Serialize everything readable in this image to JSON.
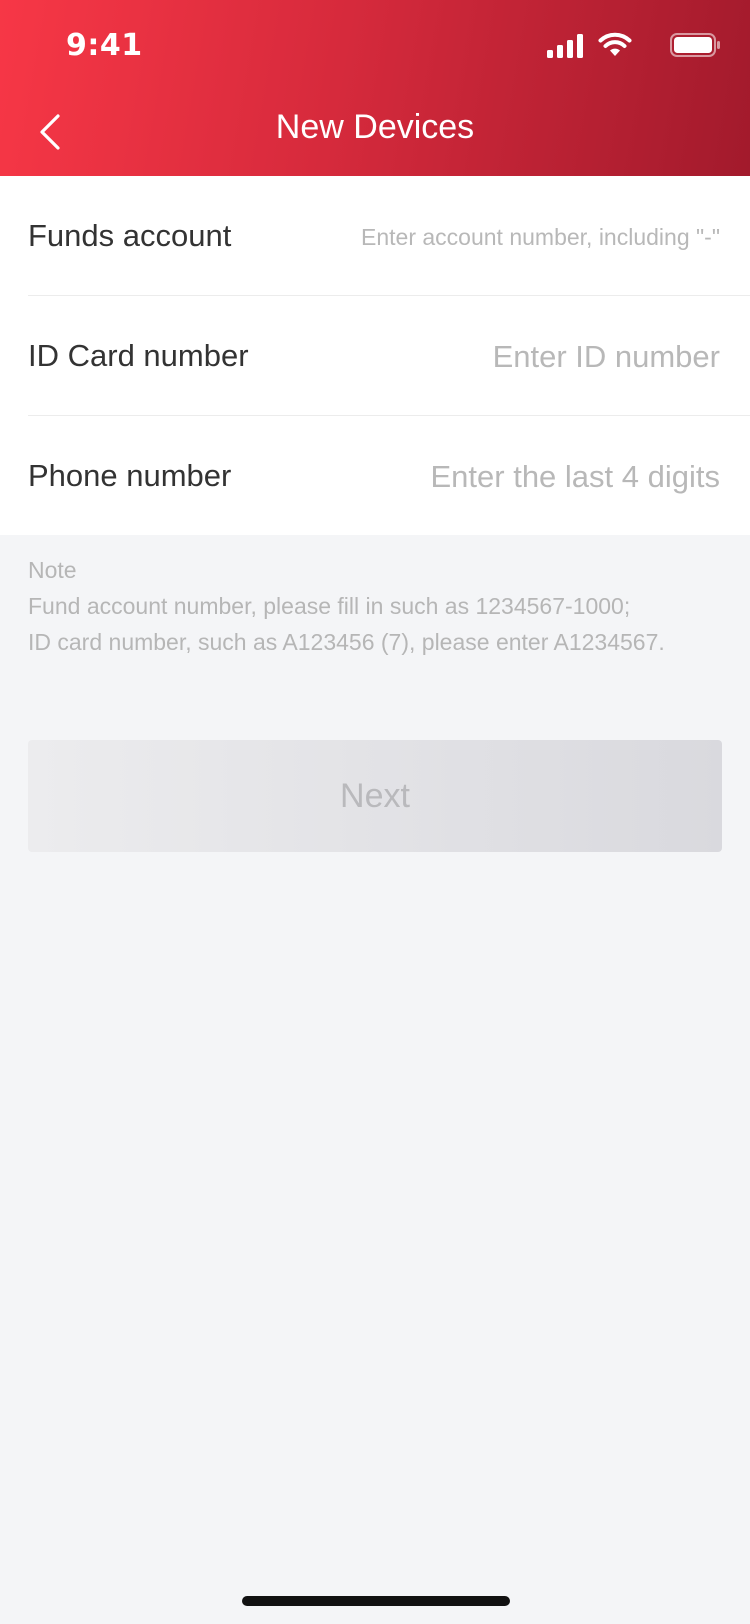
{
  "status_bar": {
    "time": "9:41"
  },
  "nav": {
    "title": "New Devices",
    "back_icon": "chevron-left-icon"
  },
  "form": {
    "fields": [
      {
        "label": "Funds account",
        "placeholder": "Enter account number, including \"-\"",
        "value": ""
      },
      {
        "label": "ID Card number",
        "placeholder": "Enter ID number",
        "value": ""
      },
      {
        "label": "Phone number",
        "placeholder": "Enter the last 4 digits",
        "value": ""
      }
    ]
  },
  "note": {
    "title": "Note",
    "lines": [
      "Fund account number, please fill in such as 1234567-1000;",
      "ID card number, such as A123456 (7), please enter A1234567."
    ]
  },
  "next_button": {
    "label": "Next",
    "enabled": false
  },
  "colors": {
    "header_start": "#f73746",
    "header_end": "#a21a2c",
    "background": "#f4f5f7",
    "placeholder": "#b8b8b8"
  }
}
